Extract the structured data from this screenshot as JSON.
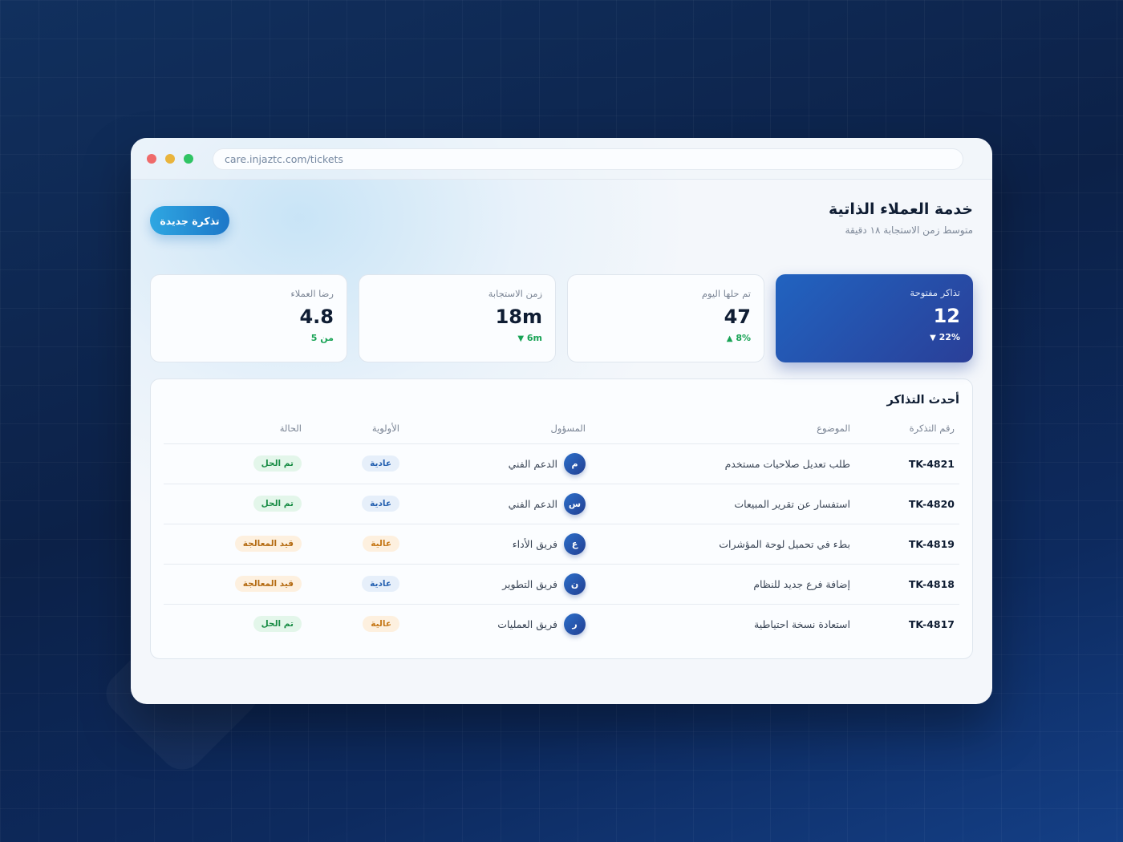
{
  "browser": {
    "url": "care.injaztc.com/tickets"
  },
  "header": {
    "title": "خدمة العملاء الذاتية",
    "subtitle": "متوسط زمن الاستجابة ١٨ دقيقة",
    "new_ticket_label": "تذكرة جديدة"
  },
  "stats": [
    {
      "label": "تذاكر مفتوحة",
      "value": "12",
      "change": "22%",
      "trend": "down"
    },
    {
      "label": "تم حلها اليوم",
      "value": "47",
      "change": "8%",
      "trend": "up"
    },
    {
      "label": "زمن الاستجابة",
      "value": "18m",
      "change": "6m",
      "trend": "down"
    },
    {
      "label": "رضا العملاء",
      "value": "4.8",
      "change": "من 5",
      "trend": "none"
    }
  ],
  "icons": {
    "arrow_up": "▲",
    "arrow_down": "▼"
  },
  "tickets": {
    "title": "أحدث التذاكر",
    "columns": [
      "رقم التذكرة",
      "الموضوع",
      "المسؤول",
      "الأولوية",
      "الحالة"
    ],
    "rows": [
      {
        "id": "TK-4821",
        "subject": "طلب تعديل صلاحيات مستخدم",
        "avatar": "م",
        "owner": "الدعم الفني",
        "priority": "عادية",
        "priority_level": "normal",
        "status": "تم الحل",
        "status_type": "resolved"
      },
      {
        "id": "TK-4820",
        "subject": "استفسار عن تقرير المبيعات",
        "avatar": "س",
        "owner": "الدعم الفني",
        "priority": "عادية",
        "priority_level": "normal",
        "status": "تم الحل",
        "status_type": "resolved"
      },
      {
        "id": "TK-4819",
        "subject": "بطء في تحميل لوحة المؤشرات",
        "avatar": "ع",
        "owner": "فريق الأداء",
        "priority": "عالية",
        "priority_level": "high",
        "status": "قيد المعالجة",
        "status_type": "progress"
      },
      {
        "id": "TK-4818",
        "subject": "إضافة فرع جديد للنظام",
        "avatar": "ن",
        "owner": "فريق التطوير",
        "priority": "عادية",
        "priority_level": "normal",
        "status": "قيد المعالجة",
        "status_type": "progress"
      },
      {
        "id": "TK-4817",
        "subject": "استعادة نسخة احتياطية",
        "avatar": "ر",
        "owner": "فريق العمليات",
        "priority": "عالية",
        "priority_level": "high",
        "status": "تم الحل",
        "status_type": "resolved"
      }
    ]
  },
  "colors": {
    "accent": "#1d77c8",
    "primary_card": "#2163c0",
    "success": "#18a355",
    "warning": "#c57716"
  }
}
